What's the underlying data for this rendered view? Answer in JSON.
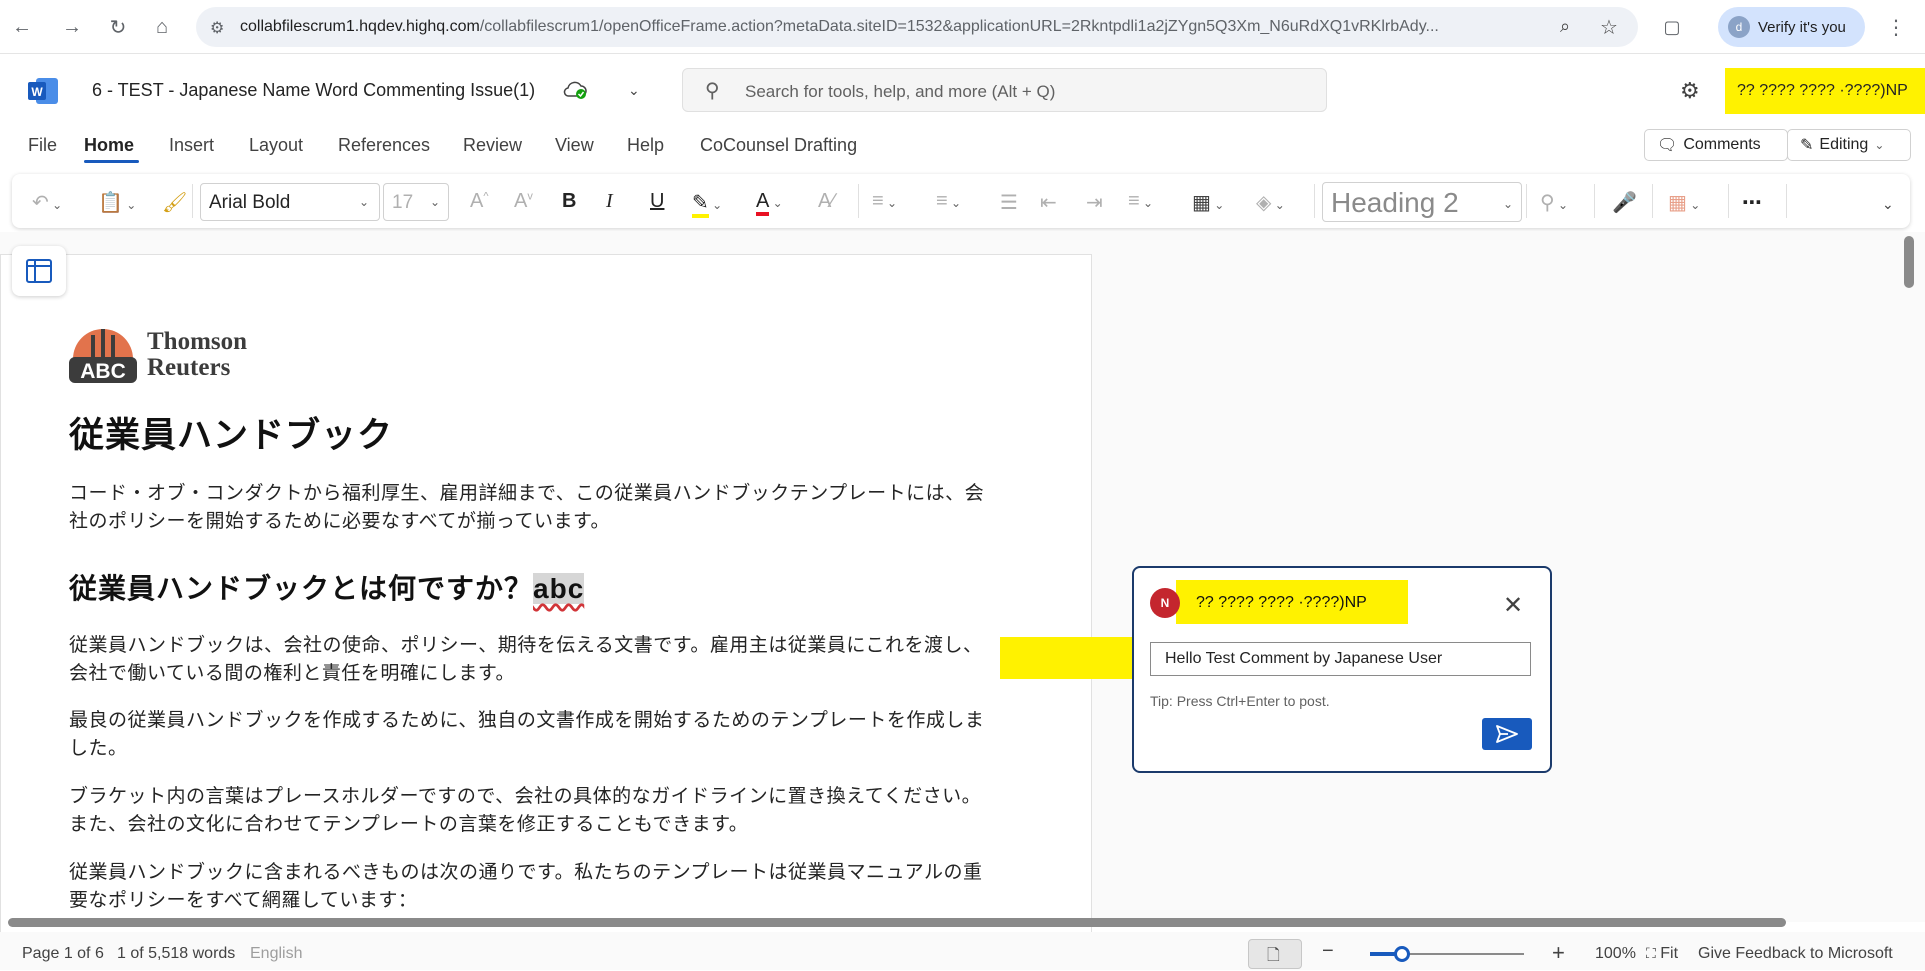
{
  "browser": {
    "url_main": "collabfilescrum1.hqdev.highq.com",
    "url_rest": "/collabfilescrum1/openOfficeFrame.action?metaData.siteID=1532&applicationURL=2Rkntpdli1a2jZYgn5Q3Xm_N6uRdXQ1vRKlrbAdy...",
    "verify_label": "Verify it's you",
    "verify_avatar": "d"
  },
  "app": {
    "logo_letter": "W",
    "doc_title": "6 - TEST - Japanese Name Word Commenting Issue(1)",
    "search_placeholder": "Search for tools, help, and more (Alt + Q)",
    "user_name": "?? ???? ???? ·????)NP"
  },
  "menu": {
    "tabs": [
      "File",
      "Home",
      "Insert",
      "Layout",
      "References",
      "Review",
      "View",
      "Help",
      "CoCounsel Drafting"
    ],
    "comments_label": "Comments",
    "editing_label": "Editing"
  },
  "ribbon": {
    "font_name": "Arial Bold",
    "font_size": "17",
    "style_name": "Heading 2"
  },
  "document": {
    "logo_line1": "Thomson",
    "logo_line2": "Reuters",
    "logo_badge": "ABC",
    "heading1": "従業員ハンドブック",
    "para1_line1": "コード・オブ・コンダクトから福利厚生、雇用詳細まで、この従業員ハンドブックテンプレートには、会",
    "para1_line2": "社のポリシーを開始するために必要なすべてが揃っています。",
    "heading2": "従業員ハンドブックとは何ですか？",
    "heading2_highlight": "abc",
    "para2_line1": "従業員ハンドブックは、会社の使命、ポリシー、期待を伝える文書です。雇用主は従業員にこれを渡し、",
    "para2_line2": "会社で働いている間の権利と責任を明確にします。",
    "para3_line1": "最良の従業員ハンドブックを作成するために、独自の文書作成を開始するためのテンプレートを作成しま",
    "para3_line2": "した。",
    "para4_line1": "ブラケット内の言葉はプレースホルダーですので、会社の具体的なガイドラインに置き換えてください。",
    "para4_line2": "また、会社の文化に合わせてテンプレートの言葉を修正することもできます。",
    "para5_line1": "従業員ハンドブックに含まれるべきものは次の通りです。私たちのテンプレートは従業員マニュアルの重",
    "para5_line2": "要なポリシーをすべて網羅しています："
  },
  "comment": {
    "avatar_initial": "N",
    "user_name": "?? ???? ???? ·????)NP",
    "input_value": "Hello Test Comment by Japanese User",
    "tip": "Tip: Press Ctrl+Enter to post."
  },
  "status": {
    "page": "Page 1 of 6",
    "words": "1 of 5,518 words",
    "language": "English",
    "zoom": "100%",
    "fit": "Fit",
    "feedback": "Give Feedback to Microsoft"
  },
  "colors": {
    "accent": "#185abd",
    "highlight": "#fff200",
    "comment_border": "#1b3a6b",
    "avatar": "#c4262e"
  }
}
